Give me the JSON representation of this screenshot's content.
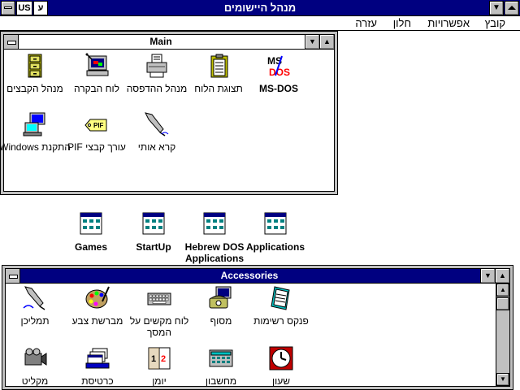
{
  "window": {
    "title": "מנהל היישומים",
    "lang_indicator_1": "US",
    "lang_indicator_2": "ע",
    "dropdown_glyph": "▼"
  },
  "menu": {
    "items": [
      "קובץ",
      "אפשרויות",
      "חלון",
      "עזרה"
    ]
  },
  "main_group": {
    "title": "Main",
    "icons": [
      {
        "label": "מנהל הקבצים",
        "icon": "file-cabinet-icon"
      },
      {
        "label": "לוח הבקרה",
        "icon": "control-panel-icon"
      },
      {
        "label": "מנהל ההדפסה",
        "icon": "printer-icon"
      },
      {
        "label": "תצוגת הלוח",
        "icon": "clipboard-icon"
      },
      {
        "label": "MS-DOS",
        "icon": "msdos-icon"
      },
      {
        "label": "התקנת Windows",
        "icon": "setup-icon"
      },
      {
        "label": "עורך קבצי PIF",
        "icon": "pif-tag-icon"
      },
      {
        "label": "קרא אותי",
        "icon": "quill-pen-icon"
      }
    ]
  },
  "minimized_groups": [
    {
      "label": "Games"
    },
    {
      "label": "StartUp"
    },
    {
      "label": "Hebrew DOS Applications"
    },
    {
      "label": "Applications"
    }
  ],
  "accessories_group": {
    "title": "Accessories",
    "icons": [
      {
        "label": "תמליכן",
        "icon": "write-pen-icon"
      },
      {
        "label": "מברשת צבע",
        "icon": "paint-palette-icon"
      },
      {
        "label": "לוח מקשים על המסך",
        "icon": "keyboard-icon"
      },
      {
        "label": "מסוף",
        "icon": "terminal-phone-icon"
      },
      {
        "label": "פנקס רשימות",
        "icon": "notepad-icon"
      },
      {
        "label": "מקליט",
        "icon": "recorder-icon"
      },
      {
        "label": "כרטיסת",
        "icon": "cardfile-icon"
      },
      {
        "label": "יומן",
        "icon": "calendar-icon"
      },
      {
        "label": "מחשבון",
        "icon": "calculator-icon"
      },
      {
        "label": "שעון",
        "icon": "clock-icon"
      }
    ]
  }
}
